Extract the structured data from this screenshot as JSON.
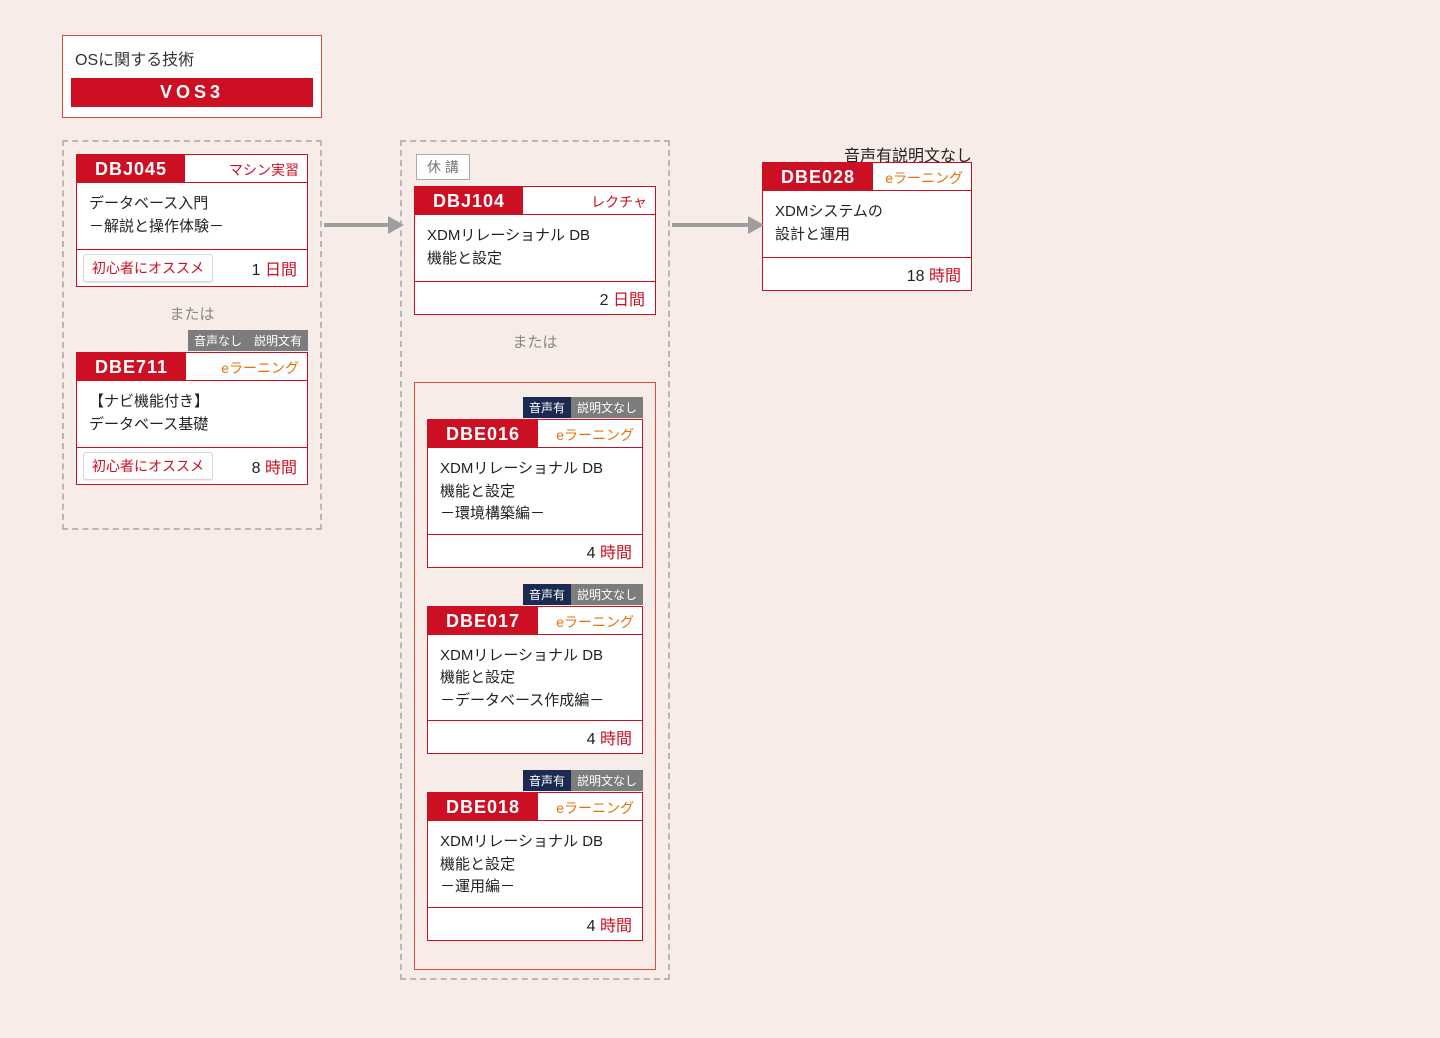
{
  "category": {
    "title": "OSに関する技術",
    "band": "VOS3"
  },
  "labels": {
    "or": "または",
    "suspended": "休 講",
    "recommend": "初心者にオススメ",
    "unit_day": "日間",
    "unit_hour": "時間"
  },
  "audio": {
    "voice_yes": "音声有",
    "voice_no": "音声なし",
    "text_yes": "説明文有",
    "text_no": "説明文なし"
  },
  "tags": {
    "machine": "マシン実習",
    "elearn": "eラーニング",
    "lecture": "レクチャ"
  },
  "col1": {
    "a": {
      "code": "DBJ045",
      "title": "データベース入門\n－解説と操作体験－",
      "duration": "1"
    },
    "b": {
      "code": "DBE711",
      "title": "【ナビ機能付き】\nデータベース基礎",
      "duration": "8"
    }
  },
  "col2": {
    "top": {
      "code": "DBJ104",
      "title": "XDMリレーショナル DB\n機能と設定",
      "duration": "2"
    },
    "e1": {
      "code": "DBE016",
      "title": "XDMリレーショナル DB\n機能と設定\n－環境構築編－",
      "duration": "4"
    },
    "e2": {
      "code": "DBE017",
      "title": "XDMリレーショナル DB\n機能と設定\n－データベース作成編－",
      "duration": "4"
    },
    "e3": {
      "code": "DBE018",
      "title": "XDMリレーショナル DB\n機能と設定\n－運用編－",
      "duration": "4"
    }
  },
  "col3": {
    "code": "DBE028",
    "title": "XDMシステムの\n設計と運用",
    "duration": "18"
  }
}
